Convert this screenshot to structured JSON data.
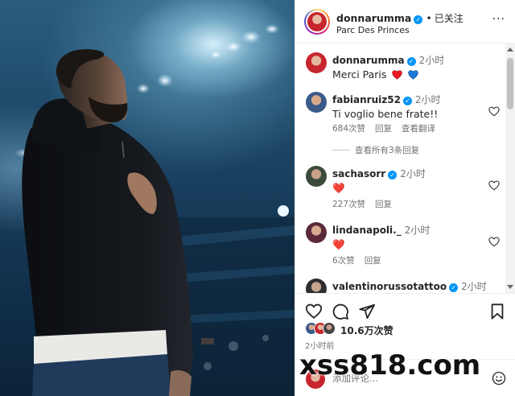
{
  "post": {
    "header": {
      "username": "donnarumma",
      "follow_status": "已关注",
      "location": "Parc Des Princes",
      "more_label": "···"
    },
    "caption": {
      "username": "donnarumma",
      "time": "2小时",
      "text": "Merci Paris"
    },
    "comments": [
      {
        "username": "fabianruiz52",
        "time": "2小时",
        "text": "Ti voglio bene frate!!",
        "likes": "684次赞",
        "reply_label": "回复",
        "translate_label": "查看翻译",
        "view_replies": "查看所有3条回复"
      },
      {
        "username": "sachasorr",
        "time": "2小时",
        "text": "❤️",
        "likes": "227次赞",
        "reply_label": "回复"
      },
      {
        "username": "lindanapoli._",
        "time": "2小时",
        "text": "❤️",
        "likes": "6次赞",
        "reply_label": "回复"
      },
      {
        "username": "valentinorussotattoo",
        "time": "2小时"
      }
    ],
    "likes_count": "10.6万次赞",
    "post_time": "2小时前",
    "add_comment_placeholder": "添加评论..."
  },
  "watermark": "xss818.com",
  "colors": {
    "verified": "#0095f6",
    "heart_red": "#ed1c24",
    "heart_blue": "#1d78d6",
    "muted_text": "#737373"
  },
  "icons": {
    "like": "heart-outline-icon",
    "comment": "comment-bubble-icon",
    "share": "paper-plane-icon",
    "save": "bookmark-icon",
    "emoji": "smiley-icon"
  }
}
